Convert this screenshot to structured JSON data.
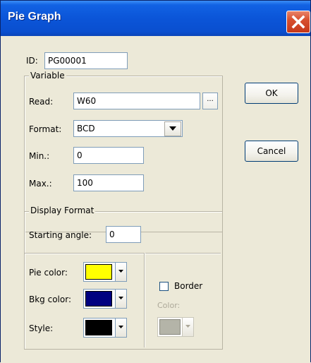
{
  "window": {
    "title": "Pie Graph"
  },
  "id_field": {
    "label": "ID:",
    "value": "PG00001"
  },
  "variable_group": {
    "title": "Variable",
    "read": {
      "label": "Read:",
      "value": "W60",
      "browse_label": "..."
    },
    "format": {
      "label": "Format:",
      "value": "BCD"
    },
    "min": {
      "label": "Min.:",
      "value": "0"
    },
    "max": {
      "label": "Max.:",
      "value": "100"
    }
  },
  "buttons": {
    "ok": "OK",
    "cancel": "Cancel"
  },
  "display_group": {
    "title": "Display Format",
    "starting_angle": {
      "label": "Starting angle:",
      "value": "0"
    },
    "pie_color": {
      "label": "Pie color:",
      "color": "#ffff00"
    },
    "bkg_color": {
      "label": "Bkg color:",
      "color": "#000080"
    },
    "style": {
      "label": "Style:",
      "color": "#000000"
    },
    "border": {
      "label": "Border",
      "checked": false
    },
    "border_color": {
      "label": "Color:",
      "color": "#b4b4a8"
    }
  }
}
